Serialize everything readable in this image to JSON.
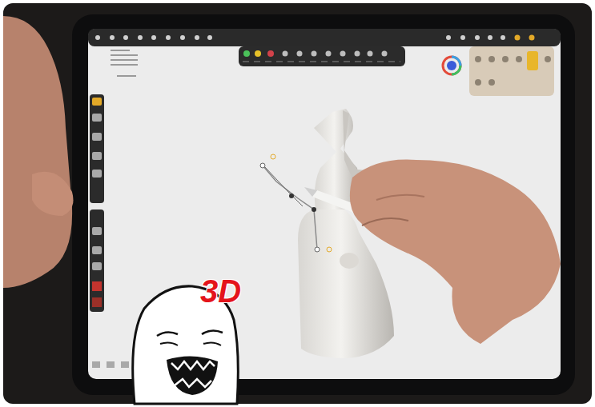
{
  "meme_overlay": {
    "caption": "3D"
  }
}
